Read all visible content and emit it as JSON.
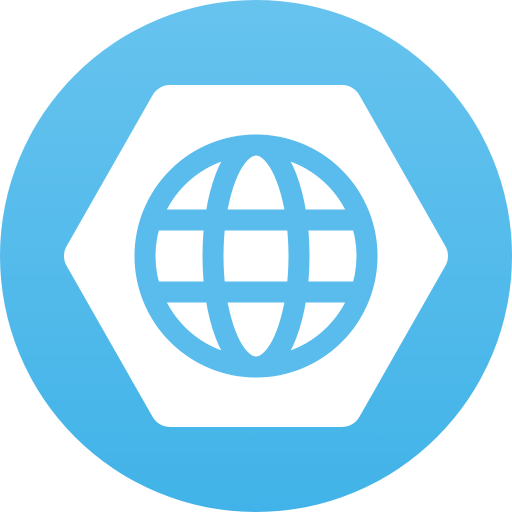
{
  "icon": {
    "name": "globe-icon",
    "shape": "hexagon-in-circle",
    "colors": {
      "circle_top": "#67C3EE",
      "circle_bottom": "#41B3E8",
      "hexagon": "#FFFFFF",
      "globe": "#59BCEC"
    }
  }
}
